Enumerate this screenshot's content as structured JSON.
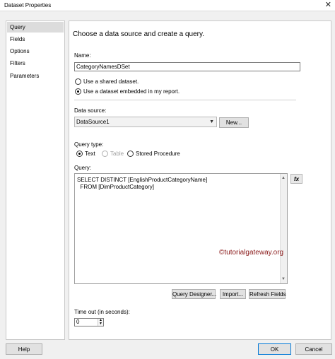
{
  "window": {
    "title": "Dataset Properties",
    "close_glyph": "✕"
  },
  "sidebar": {
    "items": [
      {
        "label": "Query"
      },
      {
        "label": "Fields"
      },
      {
        "label": "Options"
      },
      {
        "label": "Filters"
      },
      {
        "label": "Parameters"
      }
    ],
    "selected": "Query"
  },
  "main": {
    "heading": "Choose a data source and create a query.",
    "name_label": "Name:",
    "name_value": "CategoryNamesDSet",
    "shared_label": "Use a shared dataset.",
    "embedded_label": "Use a dataset embedded in my report.",
    "datasource_label": "Data source:",
    "datasource_value": "DataSource1",
    "new_button": "New...",
    "querytype_label": "Query type:",
    "querytypes": [
      "Text",
      "Table",
      "Stored Procedure"
    ],
    "query_label": "Query:",
    "query_lines": [
      "SELECT DISTINCT [EnglishProductCategoryName]",
      "  FROM [DimProductCategory]"
    ],
    "watermark": "©tutorialgateway.org",
    "fx_label": "fx",
    "query_designer_button": "Query Designer...",
    "import_button": "Import...",
    "refresh_button": "Refresh Fields",
    "timeout_label": "Time out (in seconds):",
    "timeout_value": "0"
  },
  "footer": {
    "help": "Help",
    "ok": "OK",
    "cancel": "Cancel"
  },
  "colors": {
    "watermark": "#8a1a1a",
    "accent": "#0078d7",
    "selected_bg": "#dcdcdc"
  }
}
